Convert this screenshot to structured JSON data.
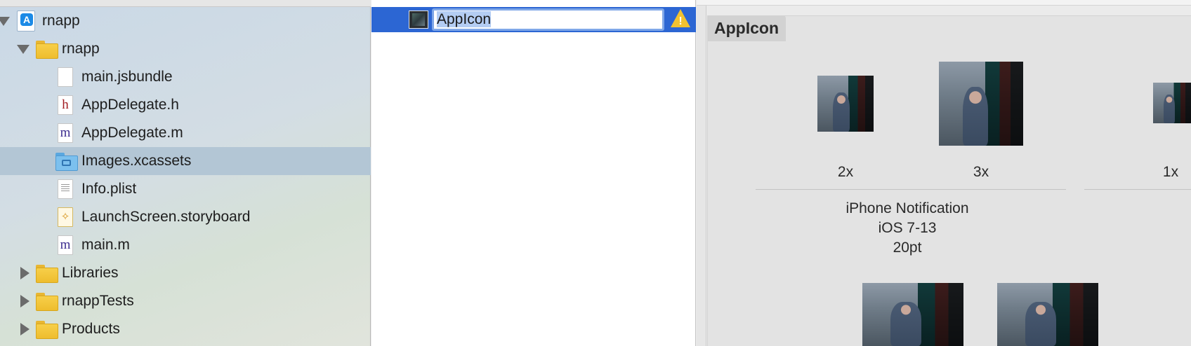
{
  "navigator": {
    "items": [
      {
        "label": "rnapp",
        "kind": "project",
        "disclosure": "down"
      },
      {
        "label": "rnapp",
        "kind": "folder",
        "disclosure": "down"
      },
      {
        "label": "main.jsbundle",
        "kind": "file-plain"
      },
      {
        "label": "AppDelegate.h",
        "kind": "file-h",
        "glyph": "h"
      },
      {
        "label": "AppDelegate.m",
        "kind": "file-m",
        "glyph": "m"
      },
      {
        "label": "Images.xcassets",
        "kind": "asset-catalog",
        "selected": true
      },
      {
        "label": "Info.plist",
        "kind": "file-plist",
        "glyph": "PLIST"
      },
      {
        "label": "LaunchScreen.storyboard",
        "kind": "file-storyboard"
      },
      {
        "label": "main.m",
        "kind": "file-m",
        "glyph": "m"
      },
      {
        "label": "Libraries",
        "kind": "folder",
        "disclosure": "right"
      },
      {
        "label": "rnappTests",
        "kind": "folder",
        "disclosure": "right"
      },
      {
        "label": "Products",
        "kind": "folder",
        "disclosure": "right"
      }
    ]
  },
  "asset_list": {
    "selected_name": "AppIcon",
    "warning_icon": "warning-triangle-icon"
  },
  "detail": {
    "set_title": "AppIcon",
    "slots": [
      {
        "scale": "2x"
      },
      {
        "scale": "3x"
      },
      {
        "scale": "1x"
      }
    ],
    "group": {
      "line1": "iPhone Notification",
      "line2": "iOS 7-13",
      "line3": "20pt"
    }
  },
  "colors": {
    "selection_blue": "#2c66d3",
    "navigator_selected": "#b3c6d5",
    "folder_yellow": "#f2c440",
    "warning_yellow": "#f2c230"
  }
}
